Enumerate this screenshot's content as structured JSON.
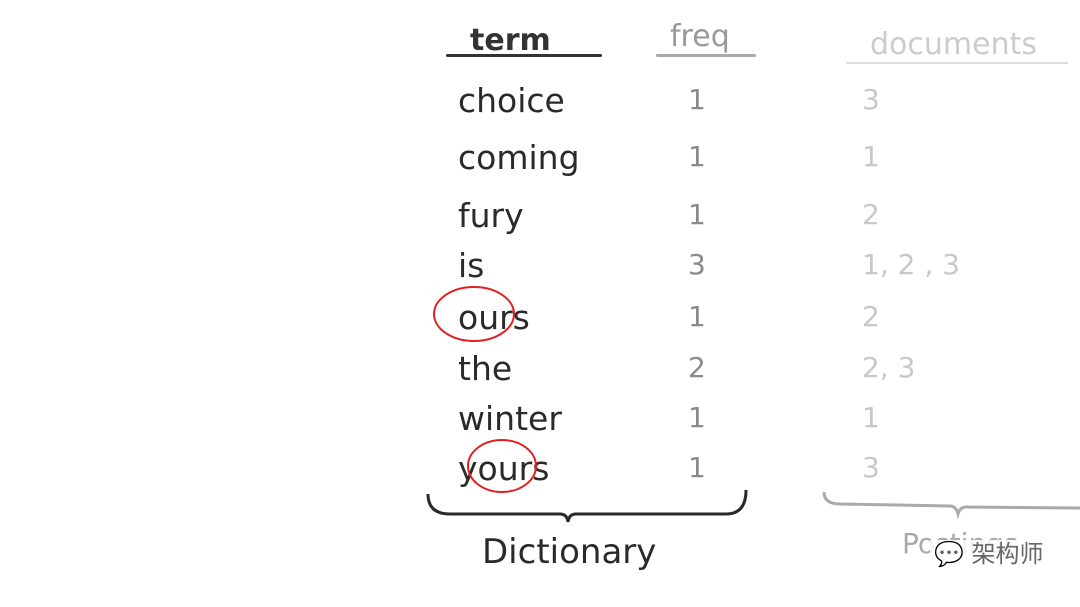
{
  "headers": {
    "term": "term",
    "freq": "freq",
    "documents": "documents"
  },
  "rows": [
    {
      "term": "choice",
      "freq": "1",
      "documents": "3"
    },
    {
      "term": "coming",
      "freq": "1",
      "documents": "1"
    },
    {
      "term": "fury",
      "freq": "1",
      "documents": "2"
    },
    {
      "term": "is",
      "freq": "3",
      "documents": "1, 2 , 3"
    },
    {
      "term": "ours",
      "freq": "1",
      "documents": "2"
    },
    {
      "term": "the",
      "freq": "2",
      "documents": "2, 3"
    },
    {
      "term": "winter",
      "freq": "1",
      "documents": "1"
    },
    {
      "term": "yours",
      "freq": "1",
      "documents": "3"
    }
  ],
  "labels": {
    "dictionary": "Dictionary",
    "postings": "Postings"
  },
  "watermark": "架构师",
  "colors": {
    "term": "#2a2a2a",
    "freq": "#8a8a8a",
    "documents": "#c8c8c8",
    "highlight": "#e02020"
  }
}
